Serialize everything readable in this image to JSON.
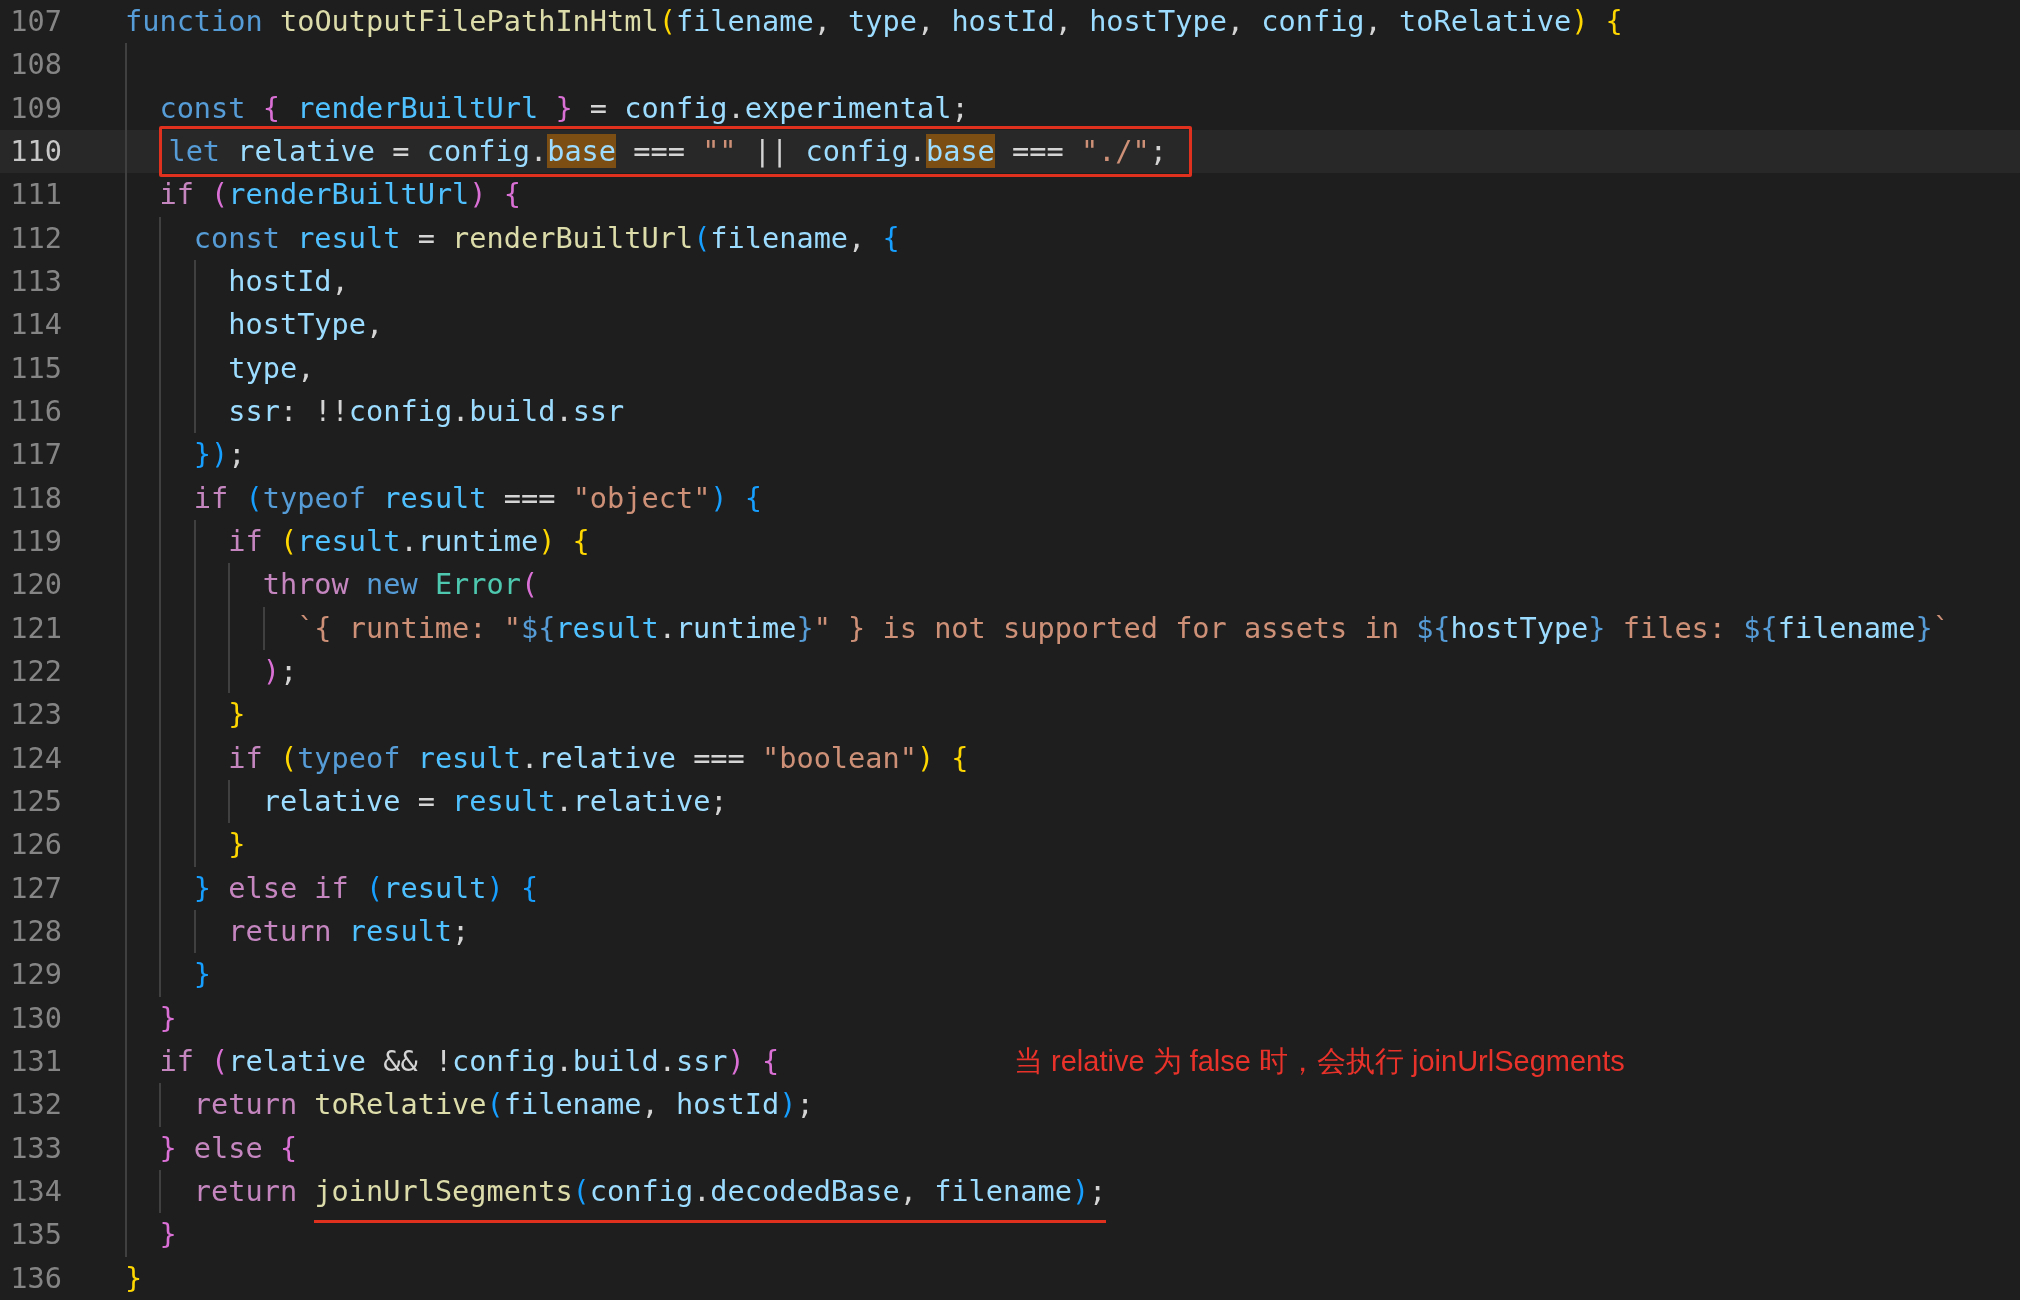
{
  "lines": [
    {
      "number": "107",
      "tokens": [
        {
          "text": "function",
          "kind": "kw"
        },
        {
          "text": " toOutputFilePathInHtml",
          "kind": "fn"
        },
        {
          "text": "(",
          "kind": "b1"
        },
        {
          "text": "filename",
          "kind": "var"
        },
        {
          "text": ", ",
          "kind": "p"
        },
        {
          "text": "type",
          "kind": "var"
        },
        {
          "text": ", ",
          "kind": "p"
        },
        {
          "text": "hostId",
          "kind": "var"
        },
        {
          "text": ", ",
          "kind": "p"
        },
        {
          "text": "hostType",
          "kind": "var"
        },
        {
          "text": ", ",
          "kind": "p"
        },
        {
          "text": "config",
          "kind": "var"
        },
        {
          "text": ", ",
          "kind": "p"
        },
        {
          "text": "toRelative",
          "kind": "var"
        },
        {
          "text": ")",
          "kind": "b1"
        },
        {
          "text": " {",
          "kind": "b1"
        }
      ]
    },
    {
      "number": "108"
    },
    {
      "number": "109",
      "tokens": [
        {
          "text": "  const",
          "kind": "kw"
        },
        {
          "text": " {",
          "kind": "b2"
        },
        {
          "text": " renderBuiltUrl",
          "kind": "const"
        },
        {
          "text": " }",
          "kind": "b2"
        },
        {
          "text": " = ",
          "kind": "p"
        },
        {
          "text": "config",
          "kind": "var"
        },
        {
          "text": ".",
          "kind": "p"
        },
        {
          "text": "experimental",
          "kind": "var"
        },
        {
          "text": ";",
          "kind": "p"
        }
      ]
    },
    {
      "number": "110",
      "highlighted": true,
      "boxed": true,
      "tokens": [
        {
          "text": "  let",
          "kind": "kw"
        },
        {
          "text": " relative",
          "kind": "var"
        },
        {
          "text": " = ",
          "kind": "p"
        },
        {
          "text": "config",
          "kind": "var"
        },
        {
          "text": ".",
          "kind": "p"
        },
        {
          "text": "base",
          "kind": "match"
        },
        {
          "text": " === ",
          "kind": "p"
        },
        {
          "text": "\"\"",
          "kind": "str"
        },
        {
          "text": " || ",
          "kind": "p"
        },
        {
          "text": "config",
          "kind": "var"
        },
        {
          "text": ".",
          "kind": "p"
        },
        {
          "text": "base",
          "kind": "match"
        },
        {
          "text": " === ",
          "kind": "p"
        },
        {
          "text": "\"./\"",
          "kind": "str"
        },
        {
          "text": ";",
          "kind": "p"
        }
      ]
    },
    {
      "number": "111",
      "tokens": [
        {
          "text": "  if",
          "kind": "ctrl"
        },
        {
          "text": " (",
          "kind": "b2"
        },
        {
          "text": "renderBuiltUrl",
          "kind": "const"
        },
        {
          "text": ")",
          "kind": "b2"
        },
        {
          "text": " {",
          "kind": "b2"
        }
      ]
    },
    {
      "number": "112",
      "tokens": [
        {
          "text": "    const",
          "kind": "kw"
        },
        {
          "text": " result",
          "kind": "const"
        },
        {
          "text": " = ",
          "kind": "p"
        },
        {
          "text": "renderBuiltUrl",
          "kind": "fn"
        },
        {
          "text": "(",
          "kind": "b3"
        },
        {
          "text": "filename",
          "kind": "var"
        },
        {
          "text": ", ",
          "kind": "p"
        },
        {
          "text": "{",
          "kind": "b3"
        }
      ]
    },
    {
      "number": "113",
      "tokens": [
        {
          "text": "      hostId",
          "kind": "var"
        },
        {
          "text": ",",
          "kind": "p"
        }
      ]
    },
    {
      "number": "114",
      "tokens": [
        {
          "text": "      hostType",
          "kind": "var"
        },
        {
          "text": ",",
          "kind": "p"
        }
      ]
    },
    {
      "number": "115",
      "tokens": [
        {
          "text": "      type",
          "kind": "var"
        },
        {
          "text": ",",
          "kind": "p"
        }
      ]
    },
    {
      "number": "116",
      "tokens": [
        {
          "text": "      ssr",
          "kind": "var"
        },
        {
          "text": ": !!",
          "kind": "p"
        },
        {
          "text": "config",
          "kind": "var"
        },
        {
          "text": ".",
          "kind": "p"
        },
        {
          "text": "build",
          "kind": "var"
        },
        {
          "text": ".",
          "kind": "p"
        },
        {
          "text": "ssr",
          "kind": "var"
        }
      ]
    },
    {
      "number": "117",
      "tokens": [
        {
          "text": "    }",
          "kind": "b3"
        },
        {
          "text": ")",
          "kind": "b3"
        },
        {
          "text": ";",
          "kind": "p"
        }
      ]
    },
    {
      "number": "118",
      "tokens": [
        {
          "text": "    if",
          "kind": "ctrl"
        },
        {
          "text": " (",
          "kind": "b3"
        },
        {
          "text": "typeof",
          "kind": "kw"
        },
        {
          "text": " result",
          "kind": "const"
        },
        {
          "text": " === ",
          "kind": "p"
        },
        {
          "text": "\"object\"",
          "kind": "str"
        },
        {
          "text": ")",
          "kind": "b3"
        },
        {
          "text": " {",
          "kind": "b3"
        }
      ]
    },
    {
      "number": "119",
      "tokens": [
        {
          "text": "      if",
          "kind": "ctrl"
        },
        {
          "text": " (",
          "kind": "b1"
        },
        {
          "text": "result",
          "kind": "const"
        },
        {
          "text": ".",
          "kind": "p"
        },
        {
          "text": "runtime",
          "kind": "var"
        },
        {
          "text": ")",
          "kind": "b1"
        },
        {
          "text": " {",
          "kind": "b1"
        }
      ]
    },
    {
      "number": "120",
      "tokens": [
        {
          "text": "        throw",
          "kind": "ctrl"
        },
        {
          "text": " new",
          "kind": "kw"
        },
        {
          "text": " Error",
          "kind": "cls"
        },
        {
          "text": "(",
          "kind": "b2"
        }
      ]
    },
    {
      "number": "121",
      "tokens": [
        {
          "text": "          `{ runtime: \"",
          "kind": "str"
        },
        {
          "text": "${",
          "kind": "tpl"
        },
        {
          "text": "result",
          "kind": "const"
        },
        {
          "text": ".",
          "kind": "p"
        },
        {
          "text": "runtime",
          "kind": "var"
        },
        {
          "text": "}",
          "kind": "tpl"
        },
        {
          "text": "\" } is not supported for assets in ",
          "kind": "str"
        },
        {
          "text": "${",
          "kind": "tpl"
        },
        {
          "text": "hostType",
          "kind": "var"
        },
        {
          "text": "}",
          "kind": "tpl"
        },
        {
          "text": " files: ",
          "kind": "str"
        },
        {
          "text": "${",
          "kind": "tpl"
        },
        {
          "text": "filename",
          "kind": "var"
        },
        {
          "text": "}",
          "kind": "tpl"
        },
        {
          "text": "`",
          "kind": "str"
        }
      ]
    },
    {
      "number": "122",
      "tokens": [
        {
          "text": "        )",
          "kind": "b2"
        },
        {
          "text": ";",
          "kind": "p"
        }
      ]
    },
    {
      "number": "123",
      "tokens": [
        {
          "text": "      }",
          "kind": "b1"
        }
      ]
    },
    {
      "number": "124",
      "tokens": [
        {
          "text": "      if",
          "kind": "ctrl"
        },
        {
          "text": " (",
          "kind": "b1"
        },
        {
          "text": "typeof",
          "kind": "kw"
        },
        {
          "text": " result",
          "kind": "const"
        },
        {
          "text": ".",
          "kind": "p"
        },
        {
          "text": "relative",
          "kind": "var"
        },
        {
          "text": " === ",
          "kind": "p"
        },
        {
          "text": "\"boolean\"",
          "kind": "str"
        },
        {
          "text": ")",
          "kind": "b1"
        },
        {
          "text": " {",
          "kind": "b1"
        }
      ]
    },
    {
      "number": "125",
      "tokens": [
        {
          "text": "        relative",
          "kind": "var"
        },
        {
          "text": " = ",
          "kind": "p"
        },
        {
          "text": "result",
          "kind": "const"
        },
        {
          "text": ".",
          "kind": "p"
        },
        {
          "text": "relative",
          "kind": "var"
        },
        {
          "text": ";",
          "kind": "p"
        }
      ]
    },
    {
      "number": "126",
      "tokens": [
        {
          "text": "      }",
          "kind": "b1"
        }
      ]
    },
    {
      "number": "127",
      "tokens": [
        {
          "text": "    }",
          "kind": "b3"
        },
        {
          "text": " else",
          "kind": "ctrl"
        },
        {
          "text": " if",
          "kind": "ctrl"
        },
        {
          "text": " (",
          "kind": "b3"
        },
        {
          "text": "result",
          "kind": "const"
        },
        {
          "text": ")",
          "kind": "b3"
        },
        {
          "text": " {",
          "kind": "b3"
        }
      ]
    },
    {
      "number": "128",
      "tokens": [
        {
          "text": "      return",
          "kind": "ctrl"
        },
        {
          "text": " result",
          "kind": "const"
        },
        {
          "text": ";",
          "kind": "p"
        }
      ]
    },
    {
      "number": "129",
      "tokens": [
        {
          "text": "    }",
          "kind": "b3"
        }
      ]
    },
    {
      "number": "130",
      "tokens": [
        {
          "text": "  }",
          "kind": "b2"
        }
      ]
    },
    {
      "number": "131",
      "annotation": "当 relative 为 false 时，会执行 joinUrlSegments",
      "tokens": [
        {
          "text": "  if",
          "kind": "ctrl"
        },
        {
          "text": " (",
          "kind": "b2"
        },
        {
          "text": "relative",
          "kind": "var"
        },
        {
          "text": " && !",
          "kind": "p"
        },
        {
          "text": "config",
          "kind": "var"
        },
        {
          "text": ".",
          "kind": "p"
        },
        {
          "text": "build",
          "kind": "var"
        },
        {
          "text": ".",
          "kind": "p"
        },
        {
          "text": "ssr",
          "kind": "var"
        },
        {
          "text": ")",
          "kind": "b2"
        },
        {
          "text": " {",
          "kind": "b2"
        }
      ]
    },
    {
      "number": "132",
      "tokens": [
        {
          "text": "    return",
          "kind": "ctrl"
        },
        {
          "text": " toRelative",
          "kind": "fn"
        },
        {
          "text": "(",
          "kind": "b3"
        },
        {
          "text": "filename",
          "kind": "var"
        },
        {
          "text": ", ",
          "kind": "p"
        },
        {
          "text": "hostId",
          "kind": "var"
        },
        {
          "text": ")",
          "kind": "b3"
        },
        {
          "text": ";",
          "kind": "p"
        }
      ]
    },
    {
      "number": "133",
      "tokens": [
        {
          "text": "  }",
          "kind": "b2"
        },
        {
          "text": " else",
          "kind": "ctrl"
        },
        {
          "text": " {",
          "kind": "b2"
        }
      ]
    },
    {
      "number": "134",
      "tokens": [
        {
          "text": "    return ",
          "kind": "ctrl"
        },
        {
          "text": "joinUrlSegments",
          "kind": "fn",
          "underlined": true
        },
        {
          "text": "(",
          "kind": "b3",
          "underlined": true
        },
        {
          "text": "config",
          "kind": "var",
          "underlined": true
        },
        {
          "text": ".",
          "kind": "p",
          "underlined": true
        },
        {
          "text": "decodedBase",
          "kind": "var",
          "underlined": true
        },
        {
          "text": ", ",
          "kind": "p",
          "underlined": true
        },
        {
          "text": "filename",
          "kind": "var",
          "underlined": true
        },
        {
          "text": ")",
          "kind": "b3",
          "underlined": true
        },
        {
          "text": ";",
          "kind": "p",
          "underlined": true
        }
      ]
    },
    {
      "number": "135",
      "tokens": [
        {
          "text": "  }",
          "kind": "b2"
        }
      ]
    },
    {
      "number": "136",
      "tokens": [
        {
          "text": "}",
          "kind": "b1"
        }
      ]
    }
  ]
}
